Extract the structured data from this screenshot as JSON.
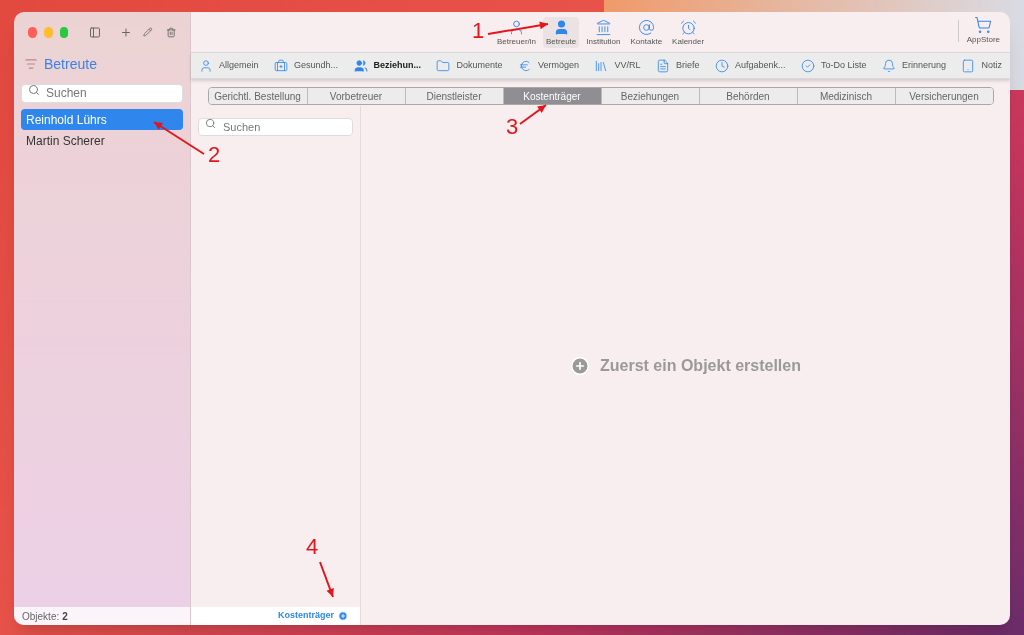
{
  "sidebar": {
    "title": "Betreute",
    "search": {
      "placeholder": "Suchen"
    },
    "items": [
      {
        "label": "Reinhold Lührs",
        "selected": true
      },
      {
        "label": "Martin Scherer",
        "selected": false
      }
    ],
    "footer": {
      "label": "Objekte:",
      "count": "2"
    }
  },
  "toolbar": {
    "items": [
      {
        "label": "Betreuer/in",
        "selected": false
      },
      {
        "label": "Betreute",
        "selected": true
      },
      {
        "label": "Institution",
        "selected": false
      },
      {
        "label": "Kontakte",
        "selected": false
      },
      {
        "label": "Kalender",
        "selected": false
      }
    ],
    "store": {
      "label": "AppStore"
    }
  },
  "tabs": [
    {
      "label": "Allgemein",
      "selected": false
    },
    {
      "label": "Gesundh...",
      "selected": false
    },
    {
      "label": "Beziehun...",
      "selected": true
    },
    {
      "label": "Dokumente",
      "selected": false
    },
    {
      "label": "Vermögen",
      "selected": false
    },
    {
      "label": "VV/RL",
      "selected": false
    },
    {
      "label": "Briefe",
      "selected": false
    },
    {
      "label": "Aufgabenk...",
      "selected": false
    },
    {
      "label": "To-Do Liste",
      "selected": false
    },
    {
      "label": "Erinnerung",
      "selected": false
    },
    {
      "label": "Notiz",
      "selected": false
    }
  ],
  "segments": [
    {
      "label": "Gerichtl. Bestellung",
      "selected": false
    },
    {
      "label": "Vorbetreuer",
      "selected": false
    },
    {
      "label": "Dienstleister",
      "selected": false
    },
    {
      "label": "Kostenträger",
      "selected": true
    },
    {
      "label": "Beziehungen",
      "selected": false
    },
    {
      "label": "Behörden",
      "selected": false
    },
    {
      "label": "Medizinisch",
      "selected": false
    },
    {
      "label": "Versicherungen",
      "selected": false
    }
  ],
  "list": {
    "search": {
      "placeholder": "Suchen"
    },
    "add_button": "Kostenträger"
  },
  "empty_state": "Zuerst ein Objekt erstellen",
  "annotations": [
    {
      "label": "1"
    },
    {
      "label": "2"
    },
    {
      "label": "3"
    },
    {
      "label": "4"
    }
  ]
}
